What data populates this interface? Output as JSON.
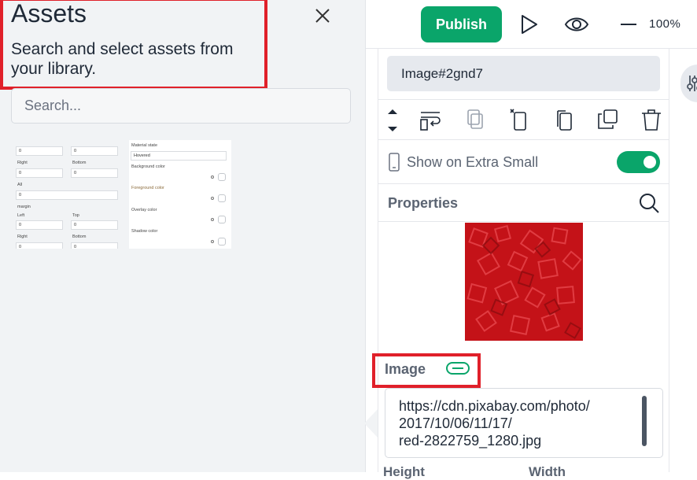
{
  "assets": {
    "title": "Assets",
    "subtitle": "Search and select assets from your library.",
    "search_placeholder": "Search...",
    "thumbnail": {
      "left": {
        "labels": [
          "Right",
          "Bottom",
          "All",
          "margin",
          "Left",
          "Top",
          "Right",
          "Bottom"
        ],
        "values": [
          "0",
          "0",
          "0",
          "0",
          "0",
          "0",
          "0",
          "0",
          "0"
        ]
      },
      "right": {
        "material_state": "Material state",
        "hovered": "Hovered",
        "background_color": "Background color",
        "foreground_color": "Foreground color",
        "overlay_color": "Overlay color",
        "shadow_color": "Shadow color"
      }
    }
  },
  "topbar": {
    "publish_label": "Publish",
    "zoom": "100%"
  },
  "properties": {
    "element_name": "Image#2gnd7",
    "show_label": "Show on Extra Small",
    "show_enabled": true,
    "section_title": "Properties",
    "image_label": "Image",
    "image_url": "https://cdn.pixabay.com/photo/2017/10/06/11/17/red-2822759_1280.jpg",
    "url_line1": "https://cdn.pixabay.com/photo/",
    "url_line2": "2017/10/06/11/17/",
    "url_line3": "red-2822759_1280.jpg",
    "height_label": "Height",
    "width_label": "Width"
  },
  "colors": {
    "accent": "#0aa56a",
    "highlight": "#e0202a",
    "panel_bg": "#f1f3f5"
  },
  "icons": [
    "close-icon",
    "play-icon",
    "eye-icon",
    "minus-icon",
    "move-up-icon",
    "move-down-icon",
    "wrap-icon",
    "copy-style-icon",
    "cut-icon",
    "copy-icon",
    "duplicate-icon",
    "trash-icon",
    "phone-icon",
    "search-icon",
    "link-icon",
    "sliders-icon"
  ]
}
